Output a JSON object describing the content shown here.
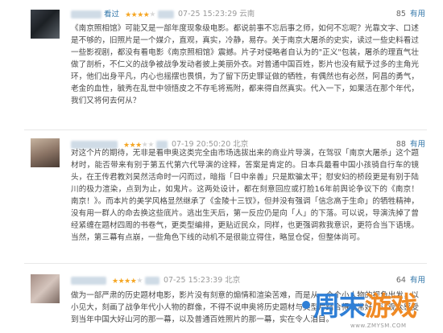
{
  "reviews": [
    {
      "username": "看过",
      "rating": 4,
      "time": "07-25 15:23:29 云南",
      "useful_count": "85",
      "useful_label": "有用",
      "text": "《南京照相馆》可能又是一部年度现象级电影。都说前事不忘后事之师，如何不忘呢？光靠文字、口述是不够的，旧照片是一个媒介，直观，真实，冷静，易存。关于南京大屠杀的史实，读过一些史料看过一些影视剧，都没有看电影《南京照相馆》震撼。片子对侵略者自认为的\"正义\"包装，屠杀的理直气壮做了剖析，不仁义的战争被战争发动者披上美丽外衣。对普通中国百姓，影片也没有赋予过多的主角光环，他们出身平凡，内心也摇摆也畏惧，为了留下历史罪证做的牺牲，有偶然也有必然，阿昌的勇气，老金的血性，毓秀在乱世中领悟皮之不存毛将焉附，都来得自然真实。代入一下，如果活在那个年代，我们又将何去何从？"
    },
    {
      "username": "",
      "rating": 3,
      "time": "07-19 20:50:20 北京",
      "useful_count": "88",
      "useful_label": "有用",
      "text": "对这个片的期待，无非是看申奥这类完全由市场选拔出来的商业片导演，在驾驭「南京大屠杀」这个题材时，能否带来有别于第五代第六代导演的诠释，答案是肯定的。日本兵最看中国小孩骑自行车的镜头，在王传君教刘昊然活命时一闪而过，暗指「日中亲善」只是欺骗太平；慰安妇的桥段更是有别于陆川的极力渲染，点到为止，如鬼片。这两处设计，都在刻意回应或打脸16年前舆论争议下的《南京！南京！》。而本片的美学风格显然继承了《金陵十三钗》，但并没有强调「信念高于生命」的牺牲精神，没有用一群人的命去换这些底片。逃出生天后，第一反应仍是向「人」的下落。可以说，导演洗掉了曾经紧缠在题材四周的书卷气，更类型编排，更贴近民众，同样，也更强调救我意识，更符合当下语境。当然，第三幕有点崩，一些角色下线的动机不是很能立得住，略显仓促，但整体尚可。"
    },
    {
      "username": "",
      "rating": 4,
      "time": "07-25 15:23:39 北京",
      "useful_count": "64",
      "useful_label": "有用",
      "text": "做为一部严肃的历史题材电影，影片没有刻意的煽情和渲染苦难，而是从一个个小人物的视角出发，以小见大，刻画了战争年代小人物的群像，不得不说申奥将历史题材与类型片结合得非常好，让观众感受到当年中国大好山河的那一幕，以及普通百姓照片的那一幕，实在令人泪目。"
    }
  ],
  "watermark": {
    "part1": "周末",
    "part2": "游戏",
    "url": "www.ZMYSM.COM"
  }
}
